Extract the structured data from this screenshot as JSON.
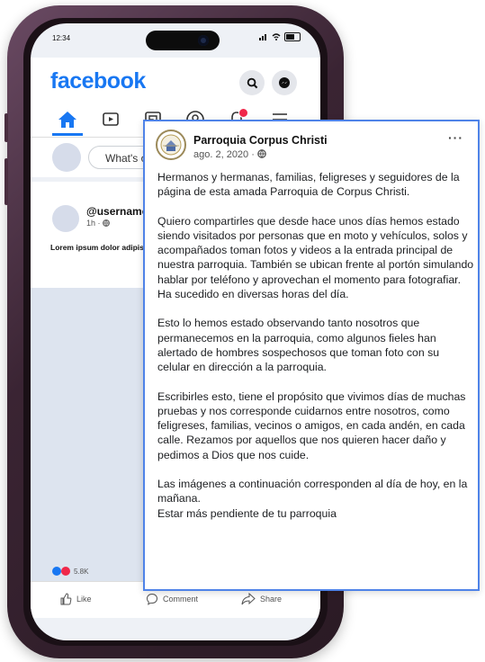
{
  "status_bar": {
    "time": "12:34"
  },
  "header": {
    "logo": "facebook"
  },
  "composer": {
    "placeholder": "What's o"
  },
  "post": {
    "username": "@username",
    "time": "1h · ",
    "text": "Lorem ipsum dolor adipiscingelit.",
    "reactions_count": "5.8K",
    "actions": {
      "like": "Like",
      "comment": "Comment",
      "share": "Share"
    }
  },
  "overlay": {
    "page_name": "Parroquia Corpus Christi",
    "date": "ago. 2, 2020 · ",
    "more": "···",
    "paragraphs": [
      "Hermanos y hermanas, familias, feligreses y seguidores de la página de esta amada Parroquia de Corpus Christi.",
      "Quiero compartirles que desde hace unos días hemos estado siendo visitados por personas que en moto y vehículos, solos y acompañados toman fotos y videos a la entrada principal de nuestra parroquia. También se ubican frente al portón simulando hablar por teléfono y aprovechan el momento para fotografiar. Ha sucedido en diversas horas del día.",
      "Esto lo hemos estado observando tanto nosotros que permanecemos en la parroquia, como algunos fieles han alertado de hombres sospechosos que toman foto con su celular en dirección a la parroquia.",
      "Escribirles esto, tiene el propósito que vivimos días de muchas pruebas y nos corresponde cuidarnos entre nosotros, como feligreses, familias, vecinos o amigos, en cada andén, en cada calle. Rezamos por aquellos que nos quieren hacer daño y pedimos a Dios que nos cuide."
    ],
    "final_line_1": "Las imágenes a continuación corresponden al día de hoy, en la mañana.",
    "final_line_2": "Estar más pendiente de tu parroquia"
  },
  "colors": {
    "brand": "#1877f2",
    "overlay_border": "#4f83e8",
    "frame": "#3a2433"
  },
  "icons": [
    "home-icon",
    "video-icon",
    "marketplace-icon",
    "profile-icon",
    "notification-bell-icon",
    "menu-icon",
    "search-icon",
    "messenger-icon",
    "globe-icon"
  ]
}
